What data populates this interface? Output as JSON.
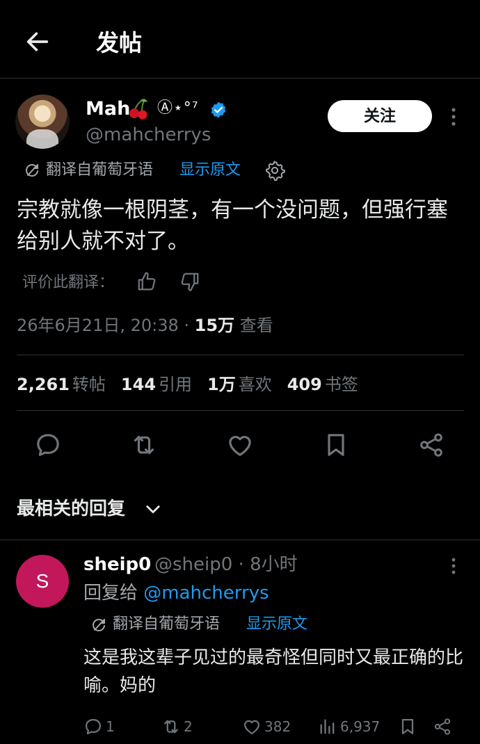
{
  "header": {
    "title": "发帖"
  },
  "post": {
    "author_name": "Mah",
    "author_suffix": "Ⓐ⋆°⁷",
    "author_handle": "@mahcherrys",
    "follow_label": "关注",
    "translation_label": "翻译自葡萄牙语",
    "show_original_label": "显示原文",
    "text": "宗教就像一根阴茎，有一个没问题，但强行塞给别人就不对了。",
    "rate_translation_label": "评价此翻译：",
    "timestamp": "26年6月21日, 20:38 · ",
    "views_count": "15万",
    "views_label": " 查看",
    "stats": {
      "reposts_count": "2,261",
      "reposts_label": "转帖",
      "quotes_count": "144",
      "quotes_label": "引用",
      "likes_count": "1万",
      "likes_label": "喜欢",
      "bookmarks_count": "409",
      "bookmarks_label": "书签"
    }
  },
  "replies_section": {
    "sort_label": "最相关的回复"
  },
  "reply": {
    "avatar_letter": "S",
    "author_name": "sheip0",
    "author_handle_time": "@sheip0 · 8小时",
    "replying_to_label": "回复给 ",
    "replying_to_handle": "@mahcherrys",
    "translation_label": "翻译自葡萄牙语",
    "show_original_label": "显示原文",
    "text": "这是我这辈子见过的最奇怪但同时又最正确的比喻。妈的",
    "reply_count": "1",
    "repost_count": "2",
    "like_count": "382",
    "view_count": "6,937"
  },
  "colors": {
    "background": "#000000",
    "accent": "#1d9bf0",
    "muted": "#71767b",
    "reply_avatar": "#c2185b"
  }
}
